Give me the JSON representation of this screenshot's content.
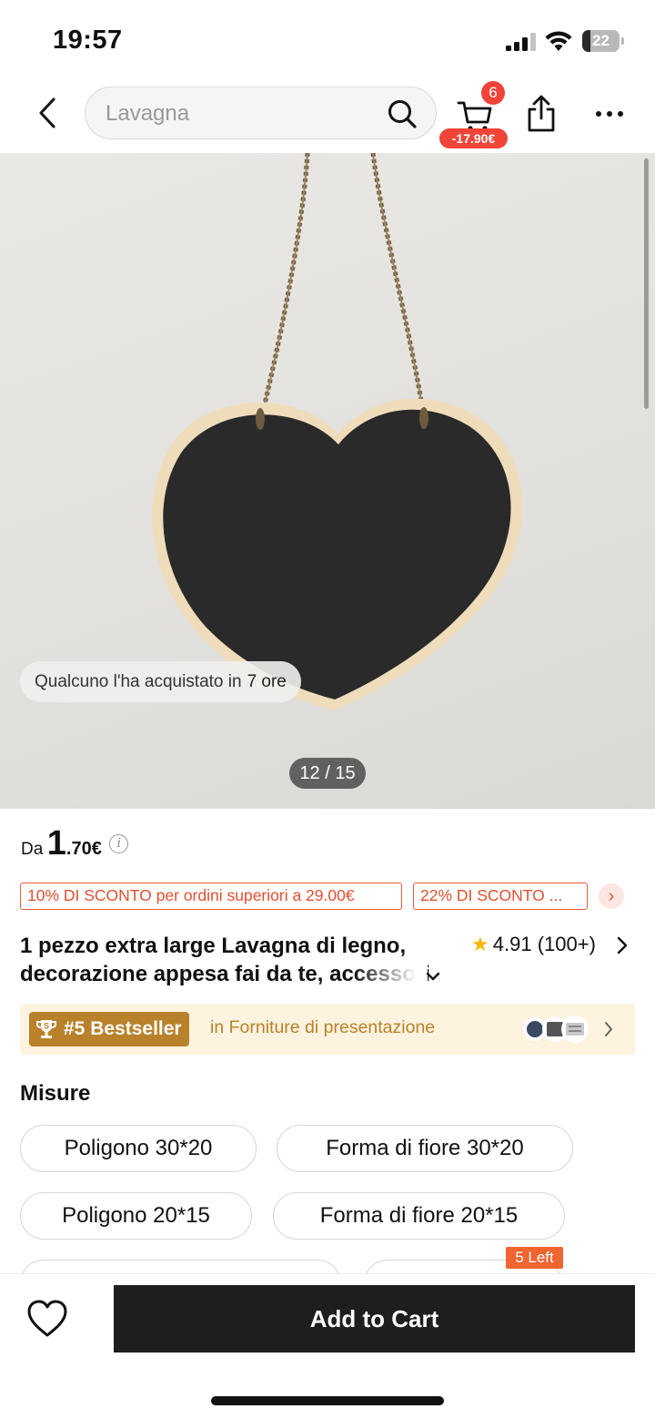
{
  "status_bar": {
    "time": "19:57",
    "battery": "22",
    "battery_level": 0.22
  },
  "header": {
    "search_placeholder": "Lavagna",
    "cart_count": "6",
    "cart_saving": "-17.90€",
    "icons": [
      "back-icon",
      "search-icon",
      "cart-icon",
      "share-icon",
      "more-icon"
    ]
  },
  "gallery": {
    "recent_purchase_text": "Qualcuno l'ha acquistato in",
    "recent_purchase_time": "7 ore",
    "counter": "12 / 15"
  },
  "price": {
    "prefix": "Da",
    "integer": "1",
    "decimal": ".70€"
  },
  "coupons": [
    "10% DI SCONTO per ordini superiori a 29.00€",
    "22% DI SCONTO ..."
  ],
  "product": {
    "title": "1 pezzo extra large Lavagna di legno, decorazione appesa fai da te, accessori",
    "rating": "4.91",
    "reviews": "(100+)"
  },
  "bestseller": {
    "rank": "#5 Bestseller",
    "category": "in Forniture di presentazione"
  },
  "sizes": {
    "title": "Misure",
    "options": [
      "Poligono 30*20",
      "Forma di fiore 30*20",
      "Poligono 20*15",
      "Forma di fiore 20*15"
    ],
    "stock_badge": "5 Left"
  },
  "bottom_bar": {
    "add_to_cart": "Add to Cart"
  },
  "colors": {
    "accent_red": "#f04438",
    "gold": "#b9812a",
    "coupon_orange": "#e0502f"
  }
}
